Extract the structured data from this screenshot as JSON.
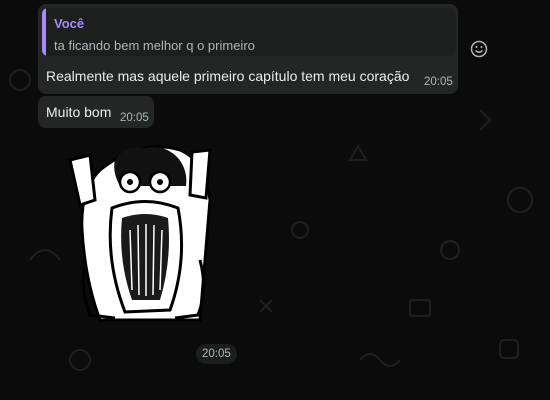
{
  "chat": {
    "messages": [
      {
        "reply": {
          "author": "Você",
          "text": "ta ficando bem melhor q o primeiro"
        },
        "text": "Realmente mas aquele primeiro capítulo tem meu coração",
        "time": "20:05"
      },
      {
        "text": "Muito bom",
        "time": "20:05"
      },
      {
        "type": "sticker",
        "time": "20:05"
      }
    ]
  },
  "icons": {
    "reaction": "smiley-icon",
    "sticker": "screaming-manga-face"
  },
  "colors": {
    "accent": "#a88bfa",
    "bubble": "#242626",
    "background": "#0b0b0b"
  }
}
